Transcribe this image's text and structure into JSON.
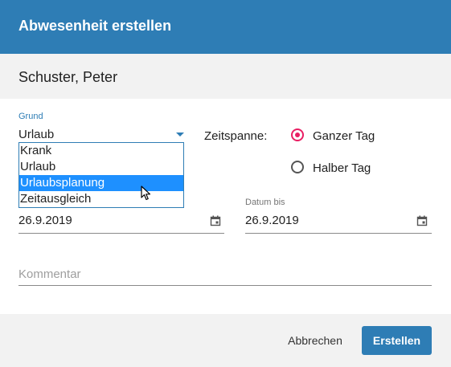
{
  "dialog": {
    "title": "Abwesenheit erstellen",
    "employee_name": "Schuster, Peter"
  },
  "form": {
    "grund": {
      "label": "Grund",
      "value": "Urlaub",
      "options": [
        "Krank",
        "Urlaub",
        "Urlaubsplanung",
        "Zeitausgleich"
      ],
      "highlighted_option": "Urlaubsplanung"
    },
    "zeitspanne": {
      "label": "Zeitspanne:",
      "options": [
        "Ganzer Tag",
        "Halber Tag"
      ],
      "selected": "Ganzer Tag"
    },
    "datum_von": {
      "value": "26.9.2019",
      "icon": "calendar-icon"
    },
    "datum_bis": {
      "label": "Datum bis",
      "value": "26.9.2019",
      "icon": "calendar-icon"
    },
    "kommentar": {
      "placeholder": "Kommentar"
    }
  },
  "footer": {
    "cancel_label": "Abbrechen",
    "create_label": "Erstellen"
  },
  "colors": {
    "primary": "#2e7db5",
    "radio_accent": "#e91e63",
    "highlight": "#1e90ff"
  }
}
